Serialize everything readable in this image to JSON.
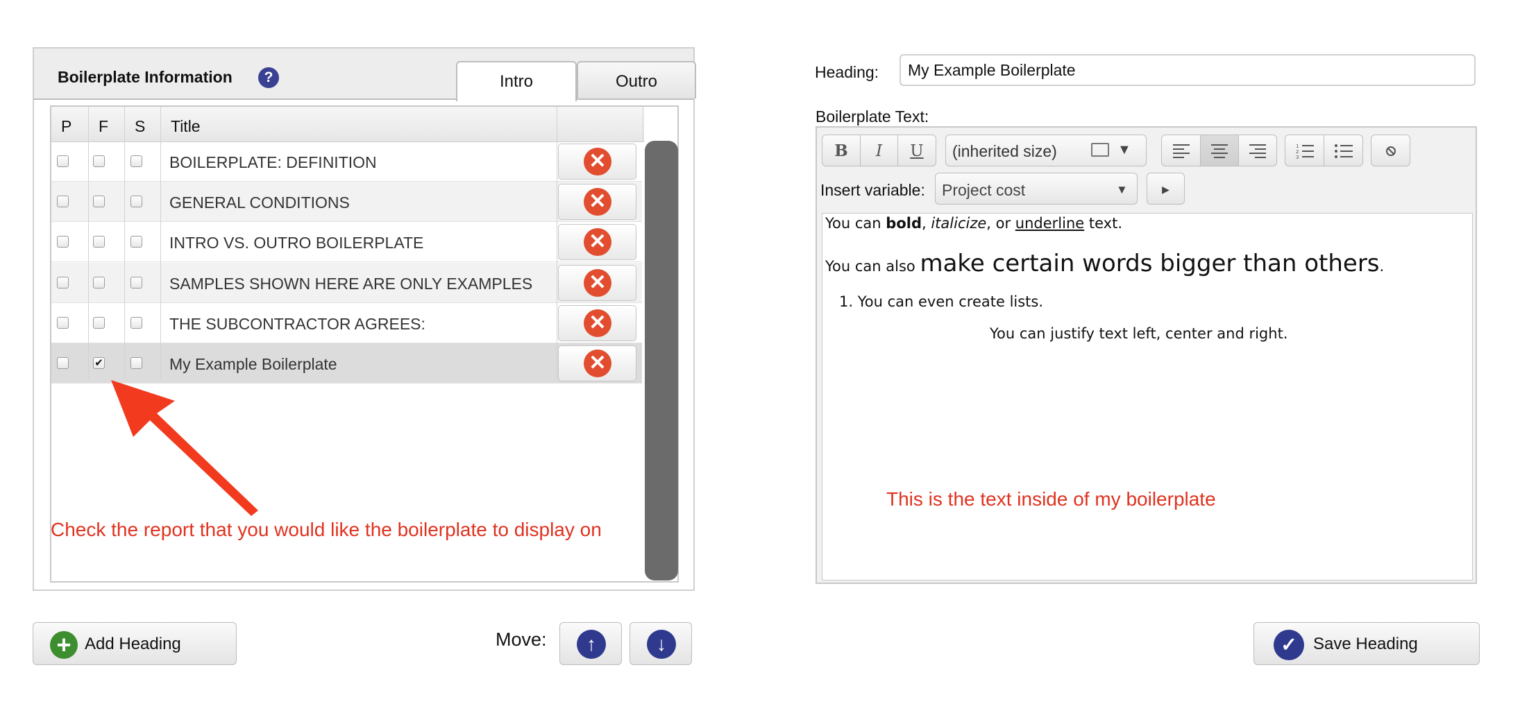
{
  "panel": {
    "title": "Boilerplate Information",
    "help": "?",
    "tabs": [
      "Intro",
      "Outro"
    ],
    "columns": {
      "p": "P",
      "f": "F",
      "s": "S",
      "title": "Title"
    },
    "rows": [
      {
        "title": "BOILERPLATE: DEFINITION",
        "p": false,
        "f": false,
        "s": false
      },
      {
        "title": "GENERAL CONDITIONS",
        "p": false,
        "f": false,
        "s": false
      },
      {
        "title": "INTRO VS. OUTRO BOILERPLATE",
        "p": false,
        "f": false,
        "s": false
      },
      {
        "title": "SAMPLES SHOWN HERE ARE ONLY EXAMPLES",
        "p": false,
        "f": false,
        "s": false
      },
      {
        "title": "THE SUBCONTRACTOR AGREES:",
        "p": false,
        "f": false,
        "s": false
      },
      {
        "title": "My Example Boilerplate",
        "p": false,
        "f": true,
        "s": false
      }
    ],
    "annotation": "Check the report that you would like the boilerplate to display on"
  },
  "buttons": {
    "add_heading": "Add Heading",
    "move_label": "Move:",
    "save_heading": "Save Heading"
  },
  "editor": {
    "heading_label": "Heading:",
    "heading_value": "My Example Boilerplate",
    "text_label": "Boilerplate Text:",
    "toolbar": {
      "bold": "B",
      "italic": "I",
      "underline": "U",
      "size": "(inherited size)"
    },
    "insert_label": "Insert variable:",
    "variable_selected": "Project cost",
    "content": {
      "l1_a": "You can ",
      "l1_bold": "bold",
      "l1_b": ", ",
      "l1_italic": "italicize",
      "l1_c": ", or ",
      "l1_underline": "underline",
      "l1_d": " text.",
      "l2_a": "You can also ",
      "l2_big": "make certain words bigger than others",
      "l2_b": ".",
      "l3": "1.  You can even create lists.",
      "l4": "You can justify text left, center and right."
    },
    "annotation": "This is the text inside of my boilerplate"
  },
  "colors": {
    "annotation": "#e0321f",
    "delete": "#e14d2e",
    "primary": "#2f3a8e",
    "add": "#3d8e2e"
  }
}
